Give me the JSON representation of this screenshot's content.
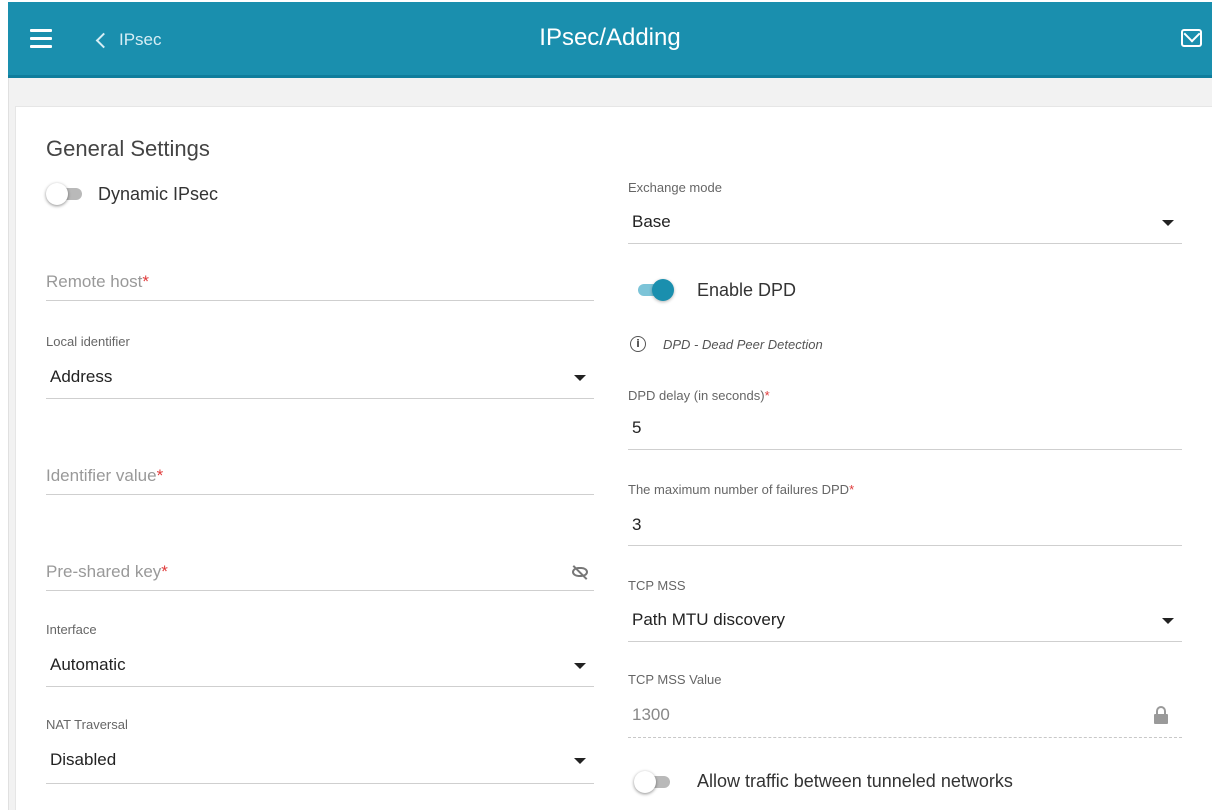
{
  "header": {
    "back_label": "IPsec",
    "title": "IPsec/Adding"
  },
  "general": {
    "title": "General Settings",
    "dynamic_ipsec_label": "Dynamic IPsec",
    "dynamic_ipsec_enabled": false
  },
  "left": {
    "remote_host_placeholder": "Remote host",
    "local_identifier_label": "Local identifier",
    "local_identifier_value": "Address",
    "identifier_value_placeholder": "Identifier value",
    "psk_placeholder": "Pre-shared key",
    "interface_label": "Interface",
    "interface_value": "Automatic",
    "nat_traversal_label": "NAT Traversal",
    "nat_traversal_value": "Disabled"
  },
  "right": {
    "exchange_mode_label": "Exchange mode",
    "exchange_mode_value": "Base",
    "enable_dpd_label": "Enable DPD",
    "enable_dpd_enabled": true,
    "dpd_info": "DPD - Dead Peer Detection",
    "dpd_delay_label": "DPD delay (in seconds)",
    "dpd_delay_value": "5",
    "dpd_max_failures_label": "The maximum number of failures DPD",
    "dpd_max_failures_value": "3",
    "tcp_mss_label": "TCP MSS",
    "tcp_mss_value": "Path MTU discovery",
    "tcp_mss_value_label": "TCP MSS Value",
    "tcp_mss_value_value": "1300",
    "allow_traffic_label": "Allow traffic between tunneled networks",
    "allow_traffic_enabled": false
  },
  "required_marker": "*",
  "colors": {
    "header_bg": "#1a8fae",
    "accent": "#1a8fae",
    "required": "#e03a3a"
  }
}
